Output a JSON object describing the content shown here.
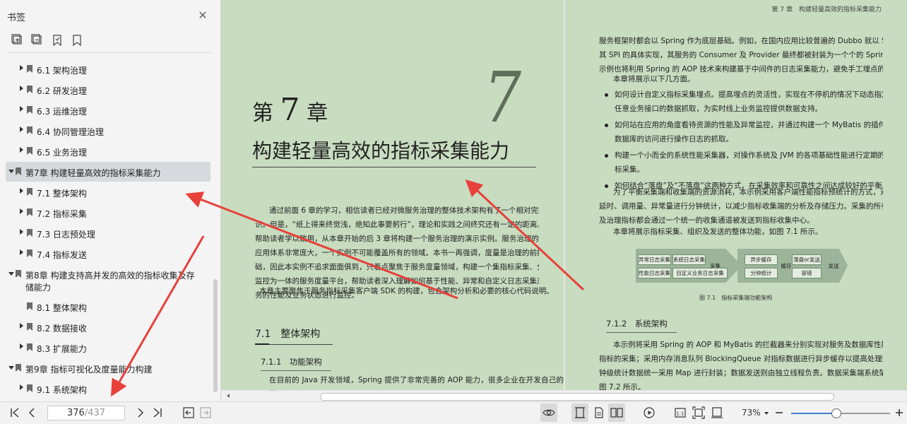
{
  "sidebar": {
    "title": "书签",
    "close_icon": "close-icon",
    "tools": [
      "add-bookmark-icon",
      "remove-bookmark-icon",
      "bookmark-flag-icon",
      "bookmark-icon"
    ],
    "items": [
      {
        "label": "6.1 架构治理",
        "level": 2,
        "expand": "collapsed"
      },
      {
        "label": "6.2 研发治理",
        "level": 2,
        "expand": "collapsed"
      },
      {
        "label": "6.3 运维治理",
        "level": 2,
        "expand": "collapsed"
      },
      {
        "label": "6.4 协同管理治理",
        "level": 2,
        "expand": "collapsed"
      },
      {
        "label": "6.5 业务治理",
        "level": 2,
        "expand": "collapsed"
      },
      {
        "label": "第7章 构建轻量高效的指标采集能力",
        "level": 1,
        "expand": "expanded",
        "selected": true
      },
      {
        "label": "7.1 整体架构",
        "level": 2,
        "expand": "collapsed"
      },
      {
        "label": "7.2 指标采集",
        "level": 2,
        "expand": "collapsed"
      },
      {
        "label": "7.3 日志预处理",
        "level": 2,
        "expand": "collapsed"
      },
      {
        "label": "7.4 指标发送",
        "level": 2,
        "expand": "collapsed"
      },
      {
        "label": "第8章 构建支持高并发的高效的指标收集及存",
        "label2": "储能力",
        "level": 1,
        "expand": "expanded"
      },
      {
        "label": "8.1 整体架构",
        "level": 2,
        "expand": "none"
      },
      {
        "label": "8.2 数据接收",
        "level": 2,
        "expand": "collapsed"
      },
      {
        "label": "8.3 扩展能力",
        "level": 2,
        "expand": "collapsed"
      },
      {
        "label": "第9章 指标可视化及度量能力构建",
        "level": 1,
        "expand": "expanded"
      },
      {
        "label": "9.1 系统架构",
        "level": 2,
        "expand": "collapsed"
      }
    ]
  },
  "left_page": {
    "chapter_label_pre": "第",
    "chapter_number": "7",
    "chapter_label_post": "章",
    "chapter_big_number": "7",
    "chapter_title": "构建轻量高效的指标采集能力",
    "intro": [
      "通过前面 6 章的学习，相信读者已经对微服务治理的整体技术架构有了一个相对完整的认",
      "识。但是，“纸上得来终觉浅，绝知此事要躬行”，理论和实践之间终究还有一定的距离。为了",
      "帮助读者学以致用，从本章开始的后 3 章将构建一个服务治理的演示实例。服务治理的技术及",
      "应用体系非常庞大，一个实例不可能覆盖所有的领域。本书一再强调，度量是治理的前提和基",
      "础，因此本实例不追求面面俱到，只着点聚焦于服务度量领域，构建一个集指标采集、分析、",
      "监控为一体的服务度量平台，帮助读者深入理解如何基于性能、异常和自定义日志采集来对服",
      "务的性能及业务状态进行监控。"
    ],
    "intro2": "本章主要聚焦于服务指标采集客户端 SDK 的构建，包含架构分析和必要的核心代码说明。",
    "h2_num": "7.1",
    "h2_title": "整体架构",
    "h3_num": "7.1.1",
    "h3_title": "功能架构",
    "last_line": "在目前的 Java 开发领域，Spring 提供了非常完善的 AOP 能力，很多企业在开发自己的微"
  },
  "right_page": {
    "running_head": "第 7 章　构建轻量高效的指标采集能力",
    "p1": [
      "服务框架时都会以 Spring 作为底层基础。例如，在国内应用比较普遍的 Dubbo 就以 Spring 作为",
      "其 SPI 的具体实现，其服务的 Consumer 及 Provider 最终都被封装为一个个的 Spring Bean。本",
      "示例也将利用 Spring 的 AOP 技术来构建基于中间件的日志采集能力，避免手工埋点的弊端。"
    ],
    "p2": "本章将展示以下几方面。",
    "bullets": [
      [
        "如何设计自定义指标采集埋点。提高埋点的灵活性，实现在不停机的情况下动态指定对",
        "任意业务接口的数据抓取，为实时线上业务监控提供数据支持。"
      ],
      [
        "如何站在应用的角度看待资源的性能及异常监控，并通过构建一个 MyBatis 的插件来对",
        "数据库的访问进行操作日志的抓取。"
      ],
      [
        "构建一个小而全的系统性能采集器，对操作系统及 JVM 的各项基础性能进行定期的指",
        "标采集。"
      ],
      [
        "如何结合“落盘”及“不落盘”这两种方式，在采集效率和可靠性之间达成较好的平衡。"
      ]
    ],
    "p3": [
      "为了平衡采集端和收集端的资源消耗，本示例采用客户端性能指标预统计的方式，对调用",
      "延时、调用量、异常量进行分钟统计，以减少指标收集端的分析及存储压力。采集的所有监控",
      "及治理指标都会通过一个统一的收集通道被发送到指标收集中心。"
    ],
    "p4": "本章将展示指标采集、组织及发送的整体功能，如图 7.1 所示。",
    "figure": {
      "boxes": [
        "异常日志采集",
        "系统日志采集",
        "性能日志采集",
        "自定义业务日志采集",
        "异步缓存",
        "分钟统计",
        "落盘or发送",
        "容错"
      ],
      "arrows": [
        "采集",
        "缓存",
        "发送"
      ],
      "caption": "图 7.1　指标采集端功能架构"
    },
    "h3_num": "7.1.2",
    "h3_title": "系统架构",
    "p5": [
      "本示例将采用 Spring 的 AOP 和 MyBatis 的拦截器来分别实现对服务及数据库性能的性能",
      "指标的采集；采用内存消息队列 BlockingQueue 对指标数据进行异步缓存以提高处理效率；分",
      "钟级统计数据统一采用 Map 进行封装；数据发送则由独立线程负责。数据采集端系统架构如",
      "图 7.2 所示。"
    ]
  },
  "toolbar": {
    "current_page": "376",
    "total_pages": "/437",
    "zoom_label": "73%",
    "zoom_fraction": 0.45,
    "icons": [
      "first-page-icon",
      "prev-page-icon",
      "next-page-icon",
      "last-page-icon",
      "back-icon",
      "forward-icon",
      "eye-icon",
      "single-page-icon",
      "continuous-icon",
      "two-page-icon",
      "play-icon",
      "actual-size-icon",
      "fit-page-icon",
      "fit-width-icon",
      "zoom-out-icon",
      "zoom-in-icon"
    ]
  },
  "colors": {
    "page_bg": "#c8dcc0",
    "arrow": "#e8403a",
    "selected_row": "#d6d9de",
    "accent": "#3b7ed0"
  }
}
